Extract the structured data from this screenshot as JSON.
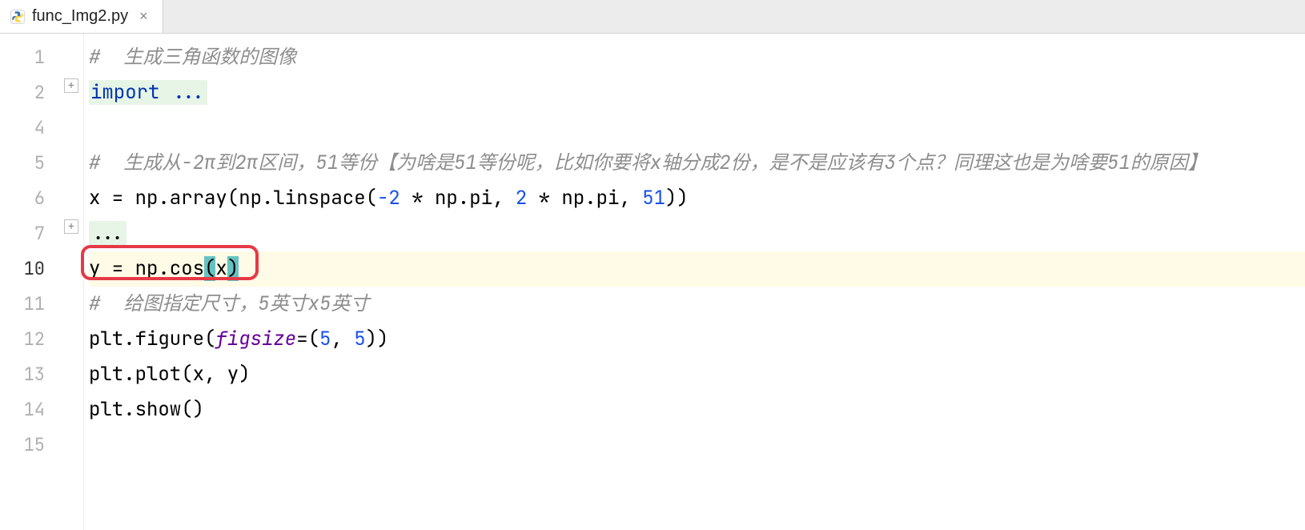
{
  "tab": {
    "filename": "func_Img2.py",
    "close_glyph": "×"
  },
  "gutter": {
    "l1": "1",
    "l2": "2",
    "l3": "4",
    "l4": "5",
    "l5": "6",
    "l6": "7",
    "l7": "10",
    "l8": "11",
    "l9": "12",
    "l10": "13",
    "l11": "14",
    "l12": "15"
  },
  "fold": {
    "expand2": "+",
    "expand7": "+"
  },
  "code": {
    "line1_comment": "#  生成三角函数的图像",
    "line2_import": "import ...",
    "line3": "",
    "line4_comment": "#  生成从-2π到2π区间，51等份【为啥是51等份呢，比如你要将x轴分成2份，是不是应该有3个点？同理这也是为啥要51的原因】",
    "line5_pre": "x = np.array(np.linspace(",
    "line5_num1": "-2",
    "line5_mid1": " * np.pi, ",
    "line5_num2": "2",
    "line5_mid2": " * np.pi, ",
    "line5_num3": "51",
    "line5_post": "))",
    "line6_fold": "...",
    "line7_pre": "y = np.cos",
    "line7_paren_open": "(",
    "line7_x": "x",
    "line7_paren_close": ")",
    "line8_comment": "#  给图指定尺寸，5英寸x5英寸",
    "line9_pre": "plt.figure(",
    "line9_kw": "figsize",
    "line9_mid": "=(",
    "line9_n1": "5",
    "line9_comma": ", ",
    "line9_n2": "5",
    "line9_post": "))",
    "line10": "plt.plot(x, y)",
    "line11": "plt.show()",
    "line12": ""
  }
}
